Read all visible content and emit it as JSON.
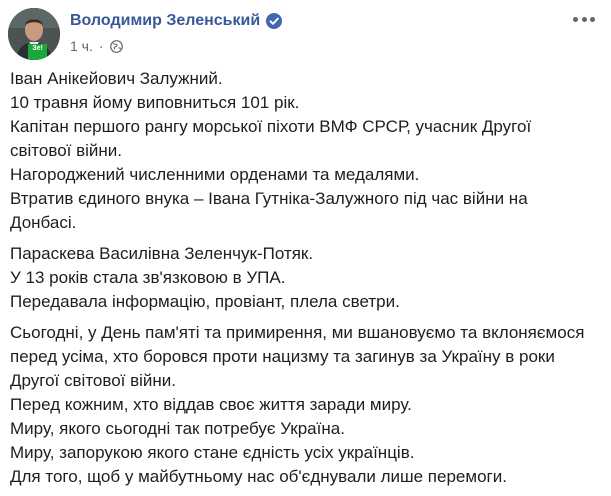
{
  "post": {
    "author": "Володимир Зеленський",
    "timestamp": "1 ч.",
    "separator": "·",
    "avatar_badge": "Зе!",
    "paragraphs": [
      [
        "Іван Анікейович Залужний.",
        "10 травня йому виповниться 101 рік.",
        "Капітан першого рангу морської піхоти ВМФ СРСР, учасник Другої",
        "світової війни.",
        "Нагороджений численними орденами та медалями.",
        "Втратив єдиного внука – Івана Гутніка-Залужного під час війни на",
        "Донбасі."
      ],
      [
        "Параскева Василівна Зеленчук-Потяк.",
        "У 13 років стала зв'язковою в УПА.",
        "Передавала інформацію, провіант, плела светри."
      ],
      [
        "Сьогодні, у День пам'яті та примирення, ми вшановуємо та вклоняємося",
        "перед усіма, хто боровся проти нацизму та загинув за Україну в роки",
        "Другої світової війни.",
        "Перед кожним, хто віддав своє життя заради миру.",
        "Миру, якого сьогодні так потребує Україна.",
        "Миру, запорукою якого стане єдність усіх українців.",
        "Для того, щоб у майбутньому нас об'єднували лише перемоги."
      ]
    ]
  },
  "icons": {
    "verified": "verified-badge-icon",
    "privacy": "globe-icon",
    "options": "more-options-icon"
  },
  "colors": {
    "author": "#385898",
    "meta": "#616770",
    "text": "#1c1e21",
    "verified": "#4267b2",
    "badge": "#1aa83a"
  }
}
